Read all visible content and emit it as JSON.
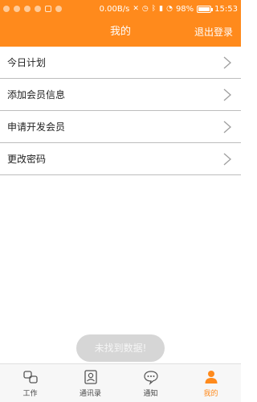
{
  "status_bar": {
    "network_speed": "0.00B/s",
    "battery_percent": "98%",
    "battery_level": 0.98,
    "time": "15:53"
  },
  "header": {
    "title": "我的",
    "action_label": "退出登录"
  },
  "menu": {
    "items": [
      {
        "label": "今日计划",
        "icon": "chevron-right-icon"
      },
      {
        "label": "添加会员信息",
        "icon": "chevron-right-icon"
      },
      {
        "label": "申请开发会员",
        "icon": "chevron-right-icon"
      },
      {
        "label": "更改密码",
        "icon": "chevron-right-icon"
      }
    ]
  },
  "toast": {
    "message": "未找到数据!"
  },
  "tabbar": {
    "tabs": [
      {
        "label": "工作",
        "icon": "work-icon",
        "active": false
      },
      {
        "label": "通讯录",
        "icon": "contacts-icon",
        "active": false
      },
      {
        "label": "通知",
        "icon": "notification-icon",
        "active": false
      },
      {
        "label": "我的",
        "icon": "profile-icon",
        "active": true
      }
    ]
  },
  "colors": {
    "accent": "#ff8a1c",
    "divider": "#bdbdbd",
    "toast_bg": "#d6d6d6"
  }
}
